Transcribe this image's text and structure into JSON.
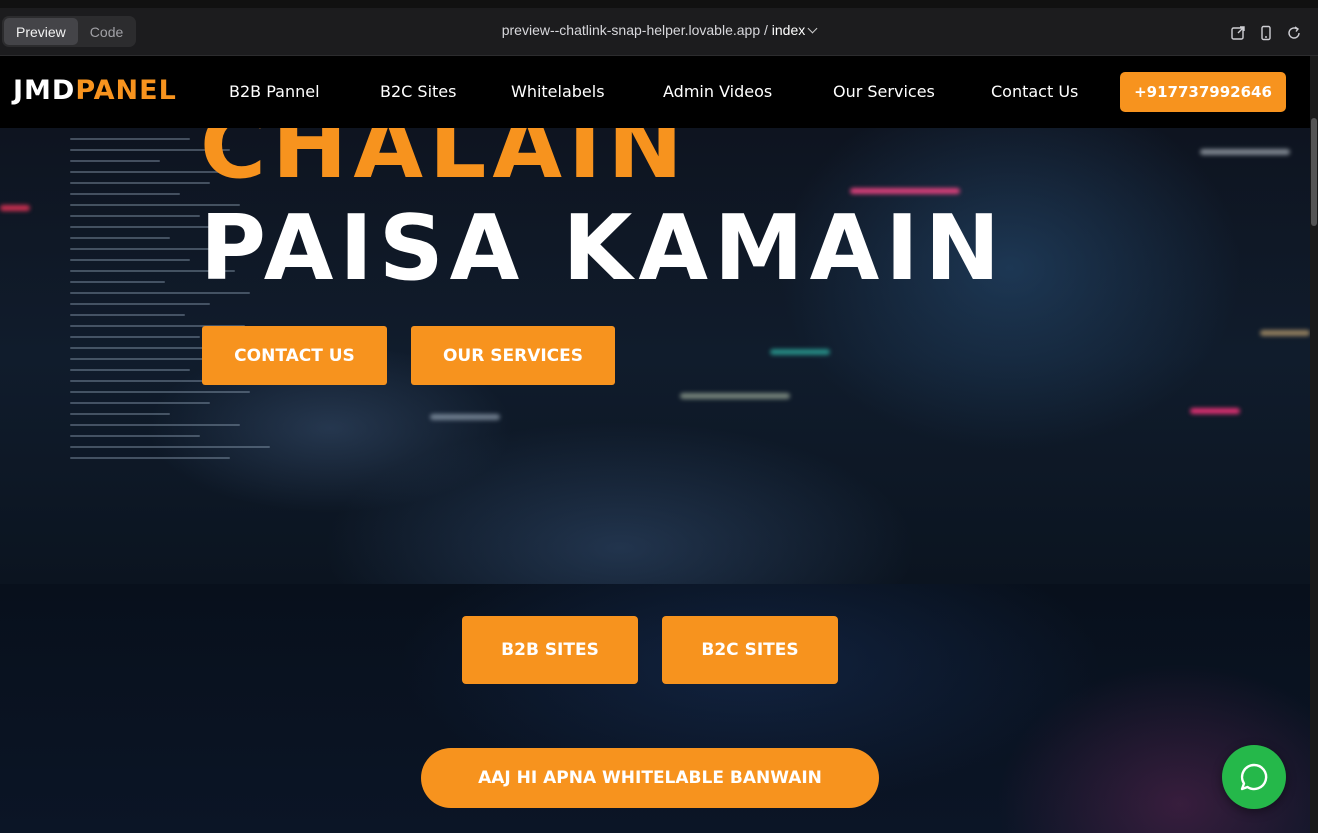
{
  "preview_bar": {
    "tabs": [
      "Preview",
      "Code"
    ],
    "active_tab": "Preview",
    "url": "preview--chatlink-snap-helper.lovable.app",
    "separator": "/",
    "route": "index",
    "icons": [
      "external-link-icon",
      "mobile-device-icon",
      "refresh-icon"
    ]
  },
  "navbar": {
    "logo_part1": "JMD",
    "logo_part2": "PANEL",
    "links": [
      "B2B Pannel",
      "B2C Sites",
      "Whitelabels",
      "Admin Videos",
      "Our Services",
      "Contact Us"
    ],
    "phone": "+917737992646"
  },
  "hero": {
    "line1": "CHALAIN",
    "line2": "PAISA KAMAIN",
    "contact_button": "CONTACT US",
    "services_button": "OUR SERVICES"
  },
  "lower": {
    "b2b_button": "B2B SITES",
    "b2c_button": "B2C SITES",
    "whitelabel_button": "AAJ HI APNA WHITELABLE BANWAIN"
  },
  "floating": {
    "icon": "chat-bubble-icon"
  },
  "colors": {
    "accent": "#f7931e",
    "whatsapp": "#25b84a",
    "navbar": "#000000"
  }
}
